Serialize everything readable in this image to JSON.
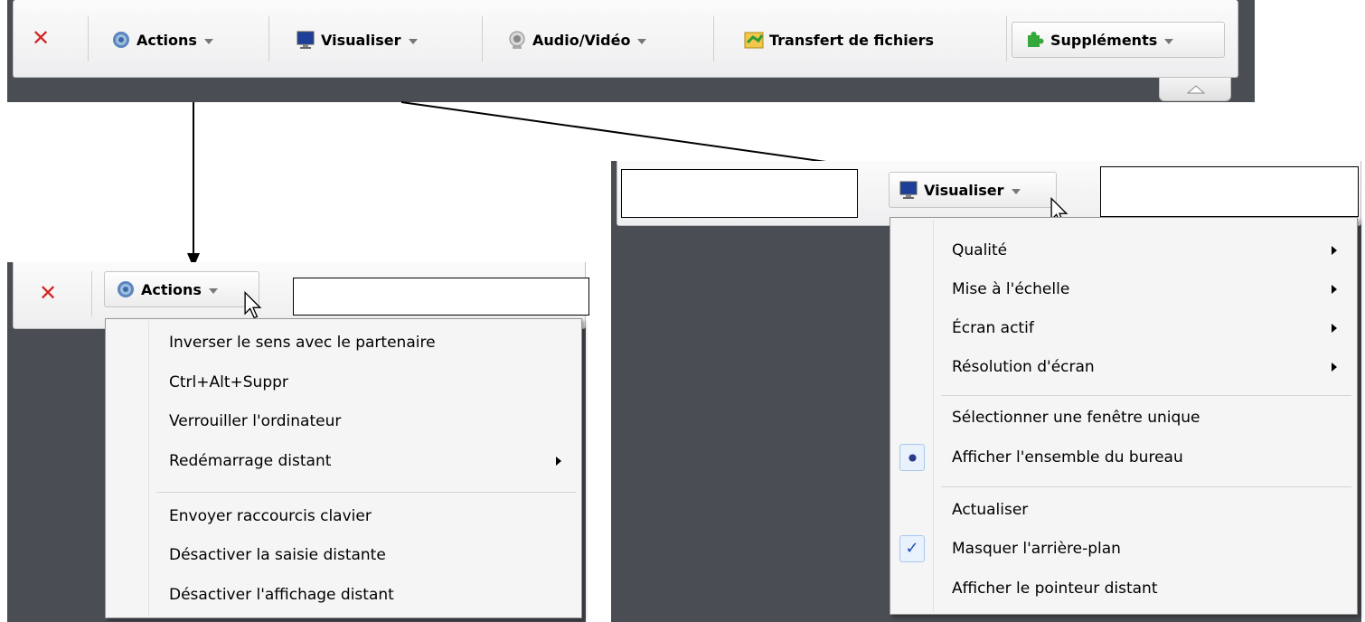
{
  "toolbar": {
    "close_icon": "close-x-icon",
    "items": [
      {
        "label": "Actions",
        "icon": "gear-icon"
      },
      {
        "label": "Visualiser",
        "icon": "monitor-icon"
      },
      {
        "label": "Audio/Vidéo",
        "icon": "webcam-icon"
      },
      {
        "label": "Transfert de fichiers",
        "icon": "file-transfer-icon"
      },
      {
        "label": "Suppléments",
        "icon": "puzzle-icon"
      }
    ],
    "collapse_icon": "collapse-up-icon"
  },
  "actions_menu": {
    "button_label": "Actions",
    "items": [
      {
        "label": "Inverser le sens avec le partenaire"
      },
      {
        "label": "Ctrl+Alt+Suppr"
      },
      {
        "label": "Verrouiller l'ordinateur"
      },
      {
        "label": "Redémarrage distant",
        "submenu": true
      },
      {
        "label": "Envoyer raccourcis clavier"
      },
      {
        "label": "Désactiver la saisie distante"
      },
      {
        "label": "Désactiver l'affichage distant"
      }
    ]
  },
  "visualiser_menu": {
    "button_label": "Visualiser",
    "items": [
      {
        "label": "Qualité",
        "submenu": true
      },
      {
        "label": "Mise à l'échelle",
        "submenu": true
      },
      {
        "label": "Écran actif",
        "submenu": true
      },
      {
        "label": "Résolution d'écran",
        "submenu": true
      },
      {
        "label": "Sélectionner une fenêtre unique"
      },
      {
        "label": "Afficher l'ensemble du bureau",
        "state": "radio-selected"
      },
      {
        "label": "Actualiser"
      },
      {
        "label": "Masquer l'arrière-plan",
        "state": "checked"
      },
      {
        "label": "Afficher le pointeur distant"
      }
    ]
  },
  "colors": {
    "background_dark": "#4b4d55",
    "close_red": "#d42424",
    "check_blue": "#1c4fb8"
  }
}
